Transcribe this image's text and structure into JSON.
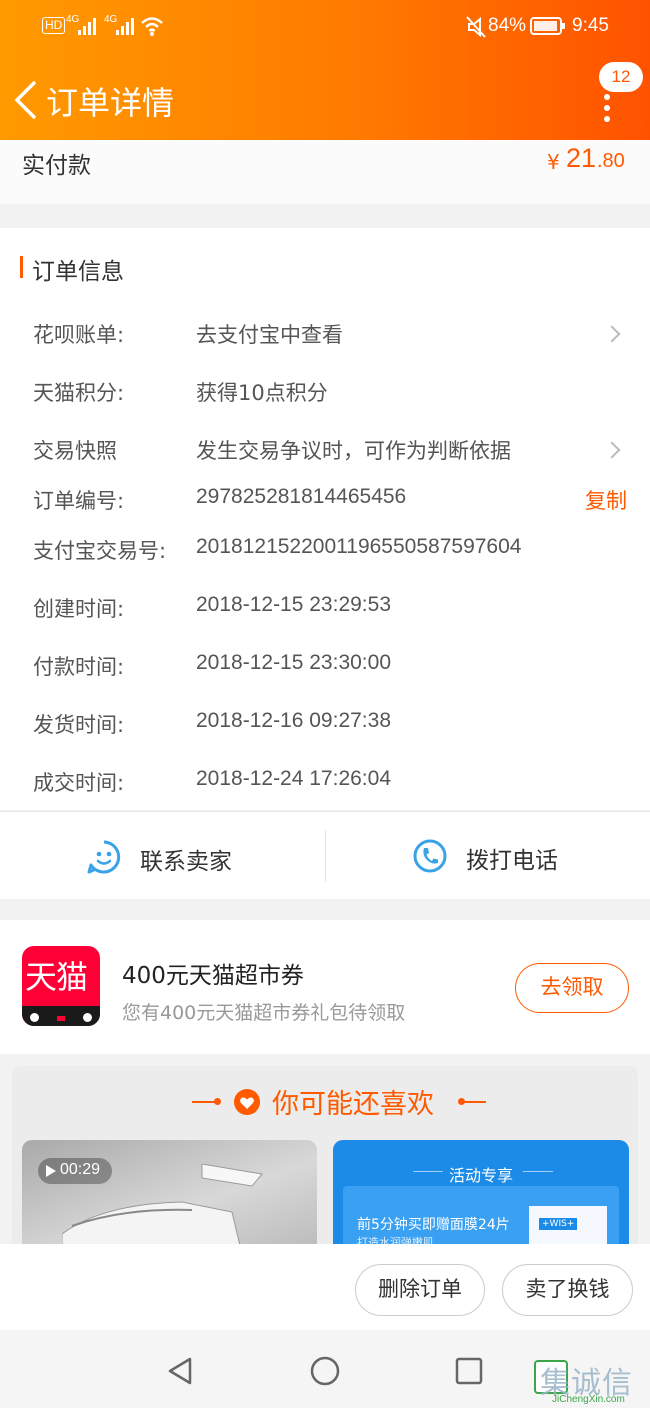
{
  "status_bar": {
    "hd": "HD",
    "net1": "4G",
    "net2": "4G",
    "battery": "84%",
    "time": "9:45"
  },
  "header": {
    "title": "订单详情",
    "badge": "12"
  },
  "paid": {
    "label": "实付款",
    "currency": "¥",
    "amount_int": "21",
    "amount_dec": ".80"
  },
  "order_info": {
    "section_title": "订单信息",
    "rows": [
      {
        "label": "花呗账单:",
        "value": "去支付宝中查看"
      },
      {
        "label": "天猫积分:",
        "value": "获得10点积分"
      },
      {
        "label": "交易快照",
        "value": "发生交易争议时，可作为判断依据"
      },
      {
        "label": "订单编号:",
        "value": "297825281814465456",
        "action": "复制"
      },
      {
        "label": "支付宝交易号:",
        "value": "2018121522001196550587597604"
      },
      {
        "label": "创建时间:",
        "value": "2018-12-15 23:29:53"
      },
      {
        "label": "付款时间:",
        "value": "2018-12-15 23:30:00"
      },
      {
        "label": "发货时间:",
        "value": "2018-12-16 09:27:38"
      },
      {
        "label": "成交时间:",
        "value": "2018-12-24 17:26:04"
      }
    ]
  },
  "contact": {
    "seller": "联系卖家",
    "phone": "拨打电话"
  },
  "coupon": {
    "logo_text": "天猫",
    "title": "400元天猫超市券",
    "subtitle": "您有400元天猫超市券礼包待领取",
    "button": "去领取"
  },
  "recommend": {
    "title": "你可能还喜欢",
    "item1": {
      "duration": "00:29"
    },
    "item2": {
      "banner": "活动专享",
      "text1": "前5分钟买即赠面膜24片",
      "text2": "打造水润弹嫩肌",
      "brand": "+WIS+"
    }
  },
  "actions": {
    "delete": "删除订单",
    "sell": "卖了换钱"
  },
  "watermark": {
    "logo": "集诚信",
    "url": "JiChengXin.com"
  },
  "colors": {
    "accent": "#ff5a00",
    "header_start": "#ff9a00",
    "header_end": "#ff5200",
    "coupon_red": "#ff0036"
  }
}
